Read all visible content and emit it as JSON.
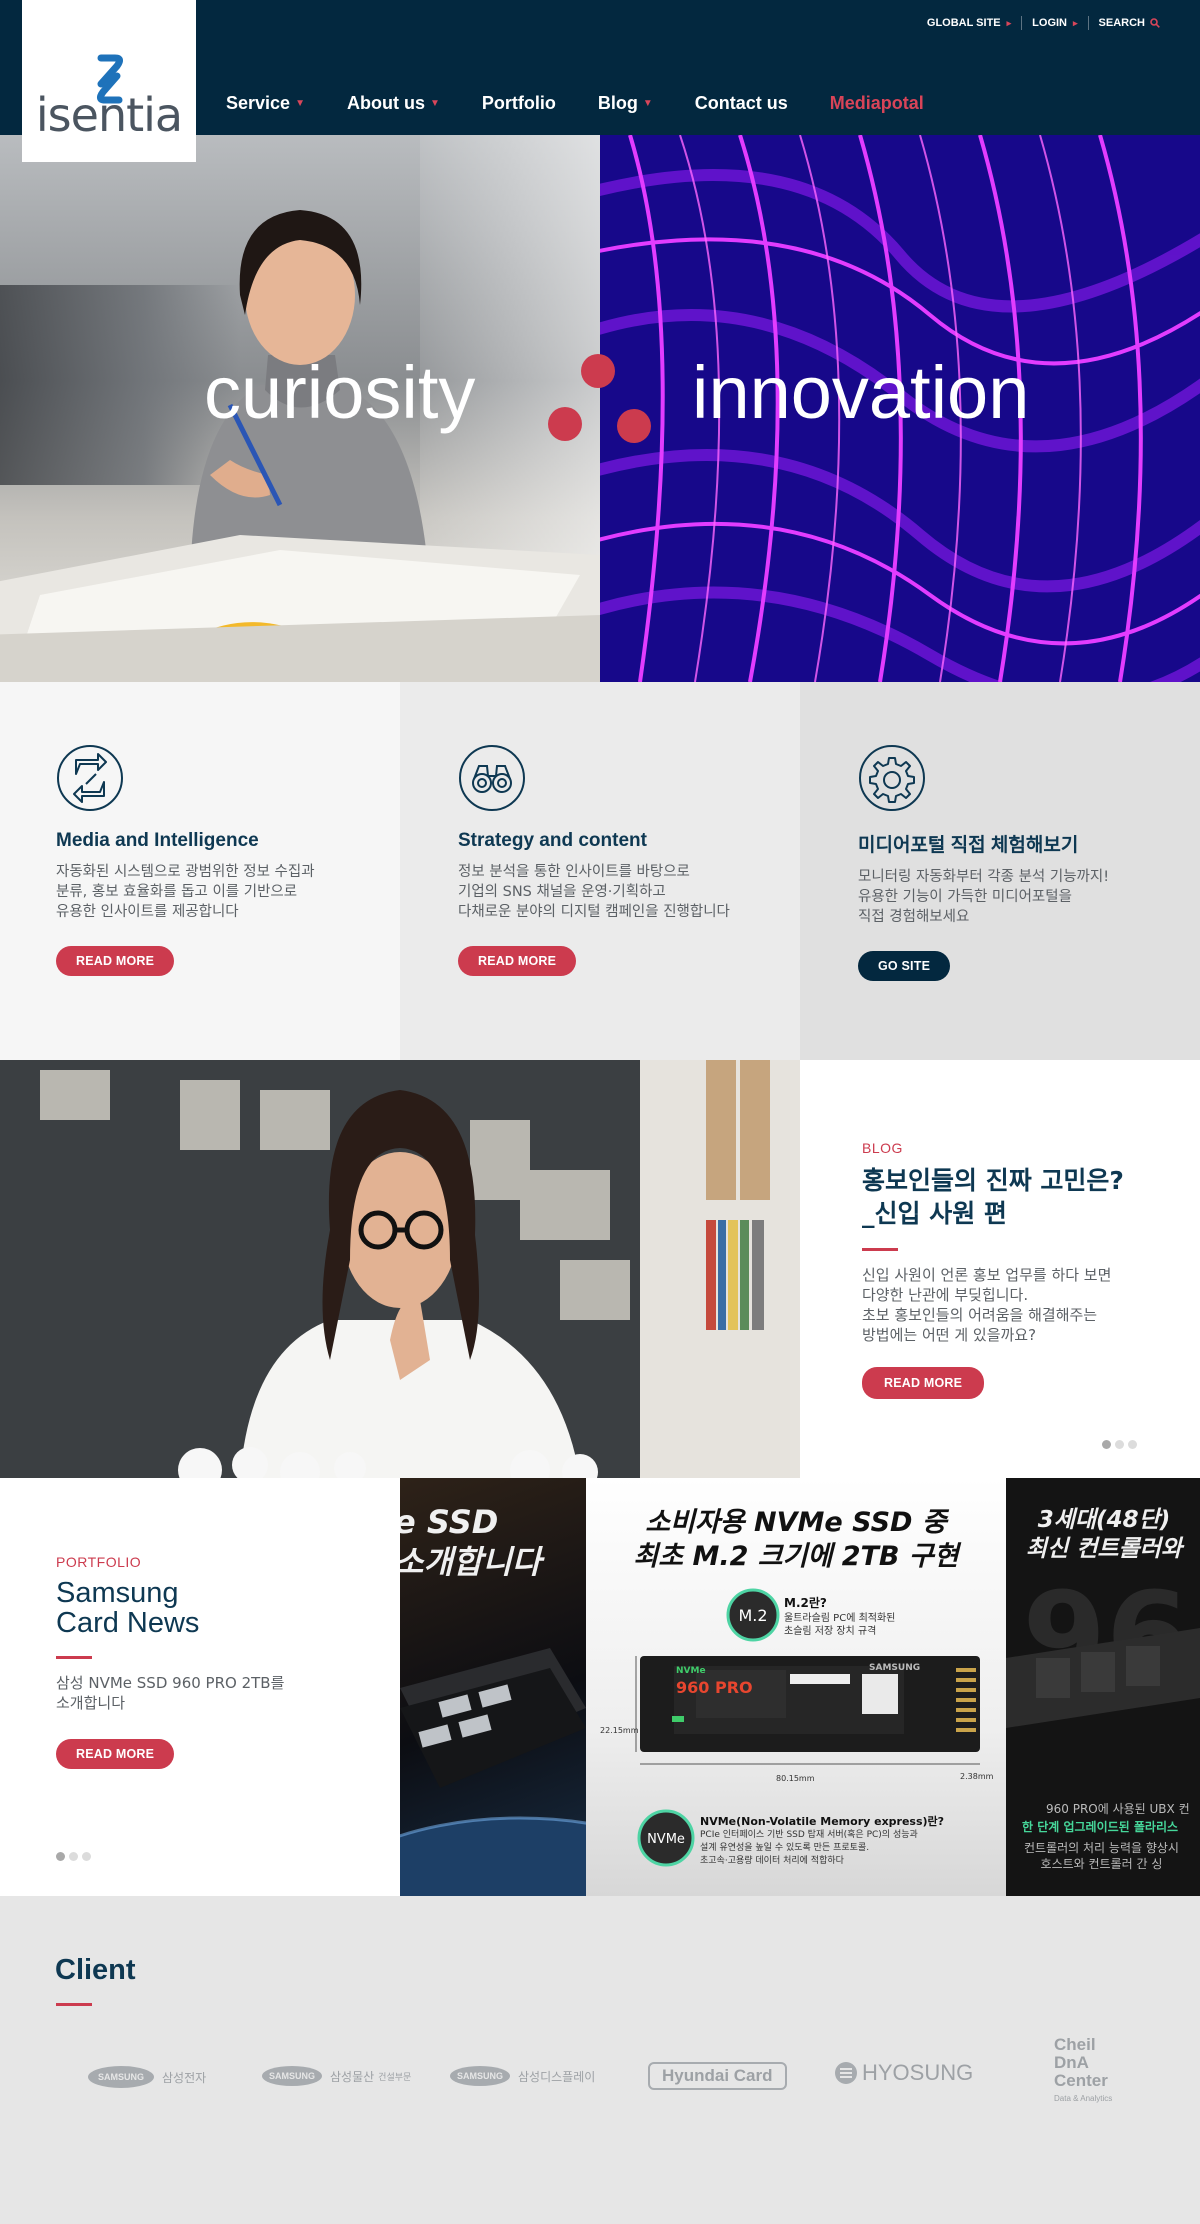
{
  "header": {
    "logo_text": "isentia",
    "topbar": {
      "global_site": "GLOBAL SITE",
      "login": "LOGIN",
      "search": "SEARCH"
    },
    "nav": [
      "Service",
      "About us",
      "Portfolio",
      "Blog",
      "Contact us",
      "Mediapotal"
    ],
    "accent_color": "#d84458",
    "bg_color": "#03283f"
  },
  "hero": {
    "left_word": "curiosity",
    "right_word": "innovation",
    "dot_color": "#cc3b4e"
  },
  "services": [
    {
      "icon": "arrows-exchange-icon",
      "title": "Media and Intelligence",
      "desc": "자동화된 시스템으로 광범위한 정보 수집과\n분류, 홍보 효율화를 돕고 이를 기반으로\n유용한 인사이트를 제공합니다",
      "button": "READ MORE"
    },
    {
      "icon": "binoculars-icon",
      "title": "Strategy and content",
      "desc": "정보 분석을 통한 인사이트를 바탕으로\n기업의 SNS 채널을 운영·기획하고\n다채로운 분야의 디지털 캠페인을 진행합니다",
      "button": "READ MORE"
    },
    {
      "icon": "gear-icon",
      "title": "미디어포털 직접 체험해보기",
      "desc": "모니터링 자동화부터 각종 분석 기능까지!\n유용한 기능이 가득한 미디어포털을\n직접 경험해보세요",
      "button": "GO SITE"
    }
  ],
  "blog": {
    "kicker": "BLOG",
    "title": "홍보인들의 진짜 고민은?\n_신입 사원 편",
    "desc": "신입 사원이 언론 홍보 업무를 하다 보면\n다양한 난관에 부딪힙니다.\n초보 홍보인들의 어려움을 해결해주는\n방법에는 어떤 게 있을까요?",
    "button": "READ MORE"
  },
  "portfolio": {
    "kicker": "PORTFOLIO",
    "title": "Samsung\nCard News",
    "desc": "삼성 NVMe SSD 960 PRO 2TB를\n소개합니다",
    "button": "READ MORE",
    "slides": {
      "a_heading": "e SSD\n소개합니다",
      "b_heading": "소비자용 NVMe SSD 중\n최초 M.2 크기에 2TB 구현",
      "b_m2_title": "M.2란?",
      "b_m2_desc": "울트라슬림 PC에 최적화된\n초슬림 저장 장치 규격",
      "b_m2_badge": "M.2",
      "b_nvme_badge": "NVMe",
      "b_nvme_title": "NVMe(Non-Volatile Memory express)란?",
      "b_nvme_desc": "PCIe 인터페이스 기반 SSD 탑재 서버(혹은 PC)의 성능과\n설계 유연성을 높일 수 있도록 만든 프로토콜.\n초고속·고용량 데이터 처리에 적합하다",
      "b_ssd_label": "960 PRO",
      "b_ssd_brand": "SAMSUNG",
      "b_dim_h": "22.15mm",
      "b_dim_w": "80.15mm",
      "b_dim_d": "2.38mm",
      "c_heading": "3세대(48단)\n최신 컨트롤러와",
      "c_text1": "960 PRO에 사용된 UBX 컨",
      "c_text2": "한 단계 업그레이드된 폴라리스",
      "c_text3": "컨트롤러의 처리 능력을 향상시\n호스트와 컨트롤러 간 싱"
    }
  },
  "client": {
    "title": "Client",
    "logos": [
      {
        "brand": "SAMSUNG",
        "sub": "삼성전자"
      },
      {
        "brand": "SAMSUNG",
        "sub": "삼성물산",
        "sub2": "건설부문"
      },
      {
        "brand": "SAMSUNG",
        "sub": "삼성디스플레이"
      },
      {
        "brand": "Hyundai Card"
      },
      {
        "brand": "HYOSUNG"
      },
      {
        "brand": "Cheil\nDnA\nCenter",
        "sub": "Data & Analytics"
      }
    ]
  }
}
